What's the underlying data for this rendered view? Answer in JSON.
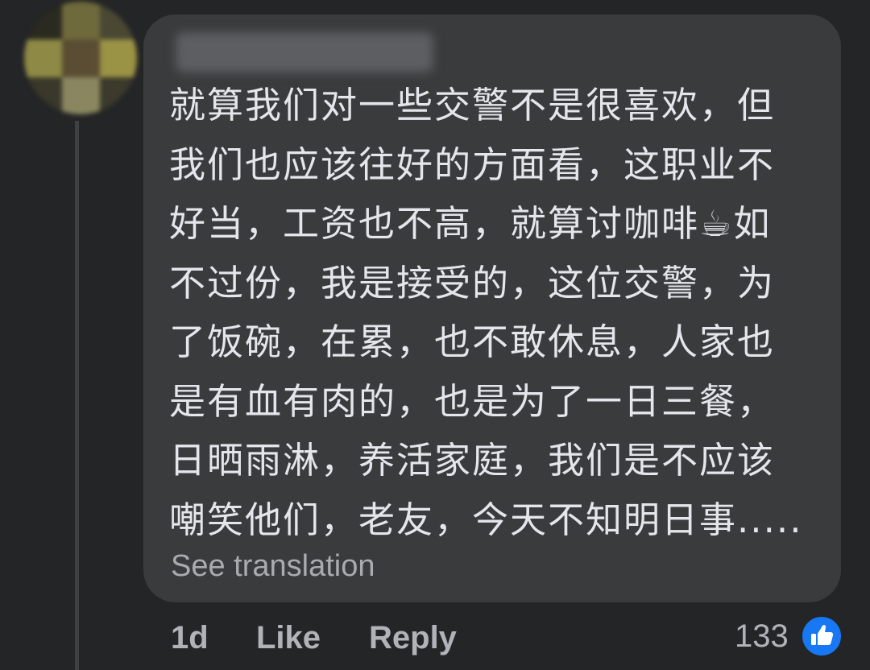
{
  "comment": {
    "lines": [
      "就算我们对一些交警不是很喜欢，但",
      "我们也应该往好的方面看，这职业不",
      "好当，工资也不高，就算讨咖啡☕如",
      "不过份，我是接受的，这位交警，为",
      "了饭碗，在累，也不敢休息，人家也",
      "是有血有肉的，也是为了一日三餐，",
      "日晒雨淋，养活家庭，我们是不应该",
      "嘲笑他们，老友，今天不知明日事....."
    ],
    "see_translation": "See translation"
  },
  "actions": {
    "time": "1d",
    "like": "Like",
    "reply": "Reply"
  },
  "reactions": {
    "count": "133",
    "icon": "thumbs-up-icon",
    "color": "#1877f2"
  },
  "colors": {
    "background": "#242526",
    "bubble": "#3a3b3c",
    "text": "#e4e6eb",
    "muted": "#b0b3b8"
  }
}
